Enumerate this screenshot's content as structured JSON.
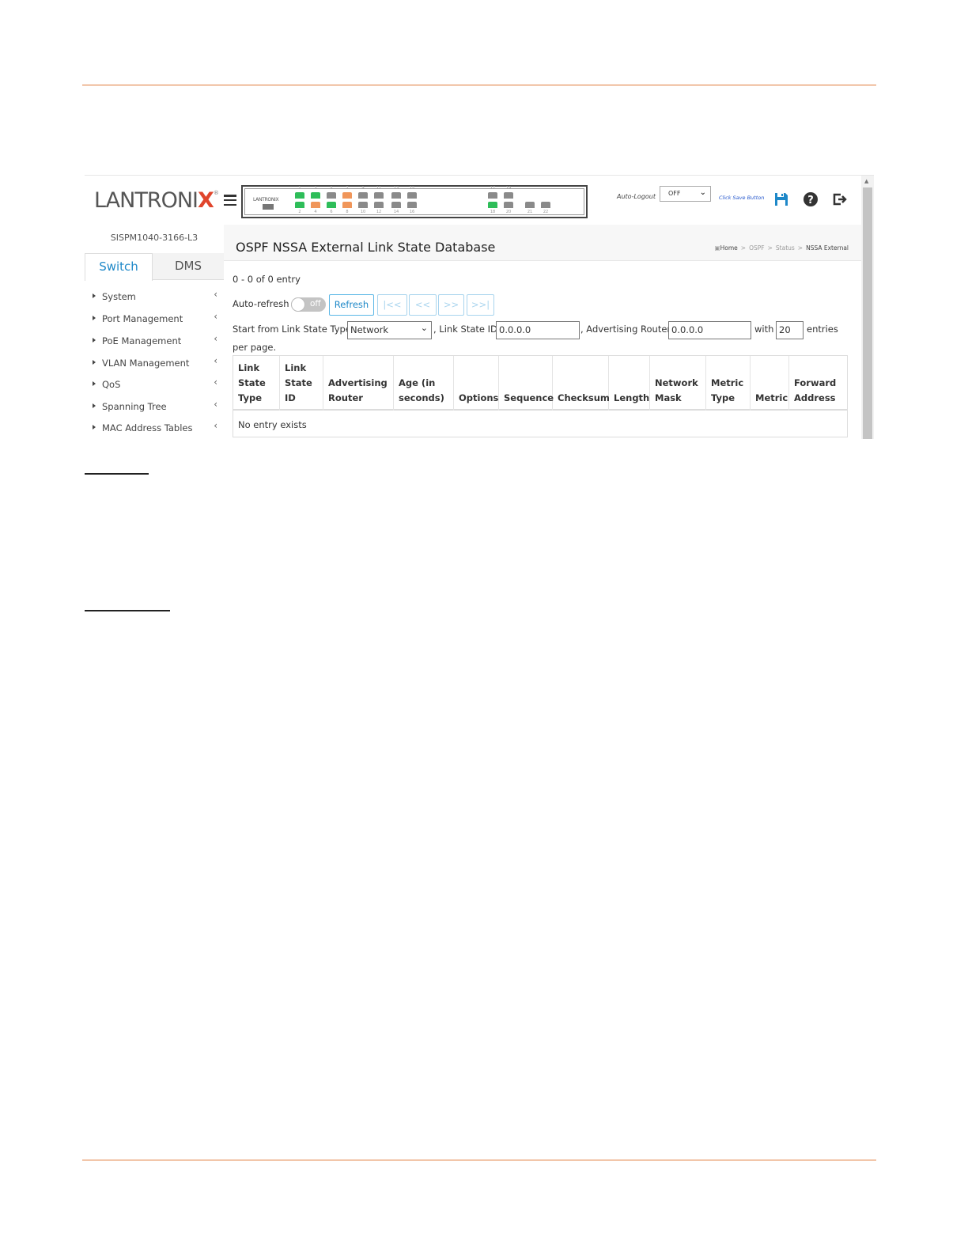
{
  "app": {
    "brand": "LANTRONIX",
    "model": "SISPM1040-3166-L3"
  },
  "device": {
    "logo": "LANTRONIX",
    "top_port_numbers": [
      "1",
      "3",
      "5",
      "7",
      "9",
      "11",
      "13",
      "15",
      "17",
      "19"
    ],
    "bottom_port_numbers": [
      "2",
      "4",
      "6",
      "8",
      "10",
      "12",
      "14",
      "16",
      "18",
      "20",
      "21",
      "22"
    ]
  },
  "header": {
    "auto_logout_label": "Auto-Logout",
    "auto_logout_value": "OFF",
    "save_hint": "Click Save Button"
  },
  "sidebar": {
    "tabs": [
      "Switch",
      "DMS"
    ],
    "items": [
      {
        "label": "System"
      },
      {
        "label": "Port Management"
      },
      {
        "label": "PoE Management"
      },
      {
        "label": "VLAN Management"
      },
      {
        "label": "QoS"
      },
      {
        "label": "Spanning Tree"
      },
      {
        "label": "MAC Address Tables"
      }
    ]
  },
  "main": {
    "title": "OSPF NSSA External Link State Database",
    "breadcrumb": [
      "Home",
      "OSPF",
      "Status",
      "NSSA External"
    ],
    "entry_count": "0 - 0 of 0 entry",
    "auto_refresh_label": "Auto-refresh",
    "auto_refresh_state": "off",
    "refresh_label": "Refresh",
    "nav_buttons": [
      "|<<",
      "<<",
      ">>",
      ">>|"
    ],
    "filter": {
      "start_label": "Start from Link State Type",
      "link_state_type": "Network",
      "link_state_id_label": ", Link State ID",
      "link_state_id": "0.0.0.0",
      "adv_router_label": ", Advertising Router",
      "adv_router": "0.0.0.0",
      "with_label": "with",
      "entries": "20",
      "entries_label": "entries",
      "per_page": "per page."
    },
    "table": {
      "headers": [
        "Link\nState\nType",
        "Link\nState\nID",
        "Advertising\nRouter",
        "Age (in\nseconds)",
        "Options",
        "Sequence",
        "Checksum",
        "Length",
        "Network\nMask",
        "Metric\nType",
        "Metric",
        "Forward\nAddress"
      ],
      "empty_text": "No entry exists"
    }
  },
  "colors": {
    "accent": "#1e88c8",
    "rule": "#e07b39",
    "brand_x": "#e0452c"
  }
}
